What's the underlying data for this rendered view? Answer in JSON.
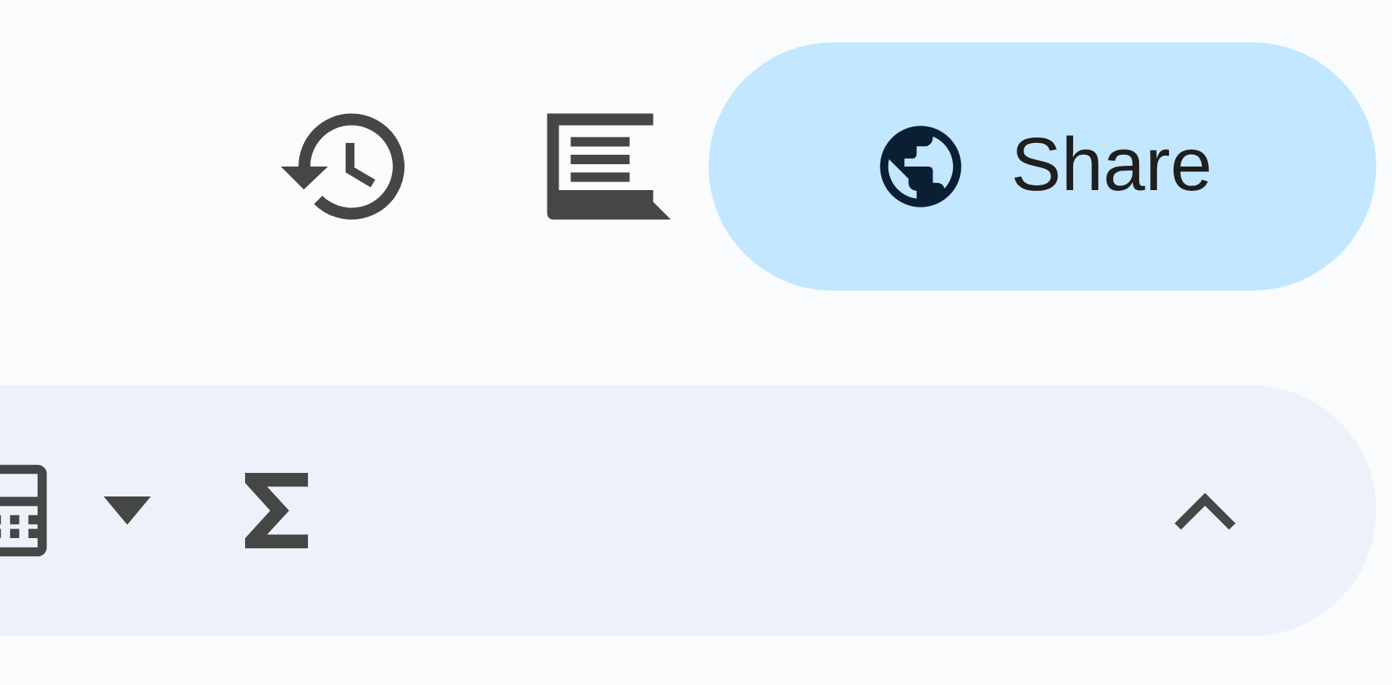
{
  "header": {
    "share_button": {
      "label": "Share"
    }
  }
}
